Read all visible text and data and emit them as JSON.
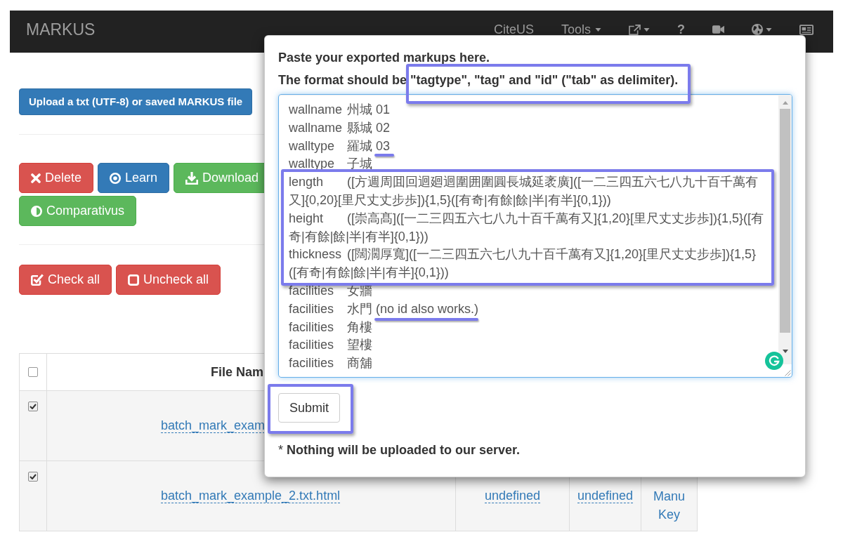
{
  "navbar": {
    "brand": "MARKUS",
    "items": [
      {
        "kind": "text",
        "label": "CiteUS",
        "dropdown": false
      },
      {
        "kind": "text",
        "label": "Tools",
        "dropdown": true
      },
      {
        "kind": "share",
        "dropdown": true
      },
      {
        "kind": "symbol",
        "label": "?",
        "dropdown": false
      },
      {
        "kind": "video",
        "dropdown": false
      },
      {
        "kind": "globe",
        "dropdown": true
      },
      {
        "kind": "newspaper",
        "dropdown": false
      }
    ]
  },
  "upload_button": {
    "label": "Upload a txt (UTF-8) or saved MARKUS file"
  },
  "actions": [
    {
      "kind": "delete",
      "label": "Delete"
    },
    {
      "kind": "learn",
      "label": "Learn"
    },
    {
      "kind": "download",
      "label": "Download"
    },
    {
      "kind": "compare",
      "label": "Comparativus"
    }
  ],
  "selection_buttons": [
    {
      "kind": "check",
      "label": "Check all"
    },
    {
      "kind": "uncheck",
      "label": "Uncheck all"
    }
  ],
  "table": {
    "header": {
      "checked": false,
      "columns": [
        "File Nam"
      ]
    },
    "rows": [
      {
        "checked": true,
        "cells": [
          "batch_mark_exam"
        ]
      },
      {
        "checked": true,
        "cells": [
          "batch_mark_example_2.txt.html",
          "undefined",
          "undefined",
          "Manu Key"
        ]
      }
    ]
  },
  "modal": {
    "intro": "Paste your exported markups here.",
    "format_note": "The format should be \"tagtype\", \"tag\" and \"id\" (\"tab\" as delimiter).",
    "markup_lines": [
      {
        "tagtype": "wallname",
        "value": "州城 01"
      },
      {
        "tagtype": "wallname",
        "value": "縣城 02"
      },
      {
        "tagtype": "walltype",
        "value": "羅城 03"
      },
      {
        "tagtype": "walltype",
        "value": "子城"
      },
      {
        "tagtype": "length",
        "value": "([方週周囬回迴廻迴圍囲圍圓長城延袤廣]([一二三四五六七八九十百千萬有又]{0,20}[里尺丈丈步歩]){1,5}([有奇|有餘|餘|半|有半]{0,1}))"
      },
      {
        "tagtype": "height",
        "value": "([崇高髙]([一二三四五六七八九十百千萬有又]{1,20}[里尺丈丈步歩]){1,5}([有奇|有餘|餘|半|有半]{0,1}))"
      },
      {
        "tagtype": "thickness",
        "value": "([闊濶厚寬]([一二三四五六七八九十百千萬有又]{1,20}[里尺丈丈步歩]){1,5}([有奇|有餘|餘|半|有半]{0,1}))"
      },
      {
        "tagtype": "facilities",
        "value": "女牆"
      },
      {
        "tagtype": "facilities",
        "value": "水門 (no id also works.)"
      },
      {
        "tagtype": "facilities",
        "value": "角樓"
      },
      {
        "tagtype": "facilities",
        "value": "望樓"
      },
      {
        "tagtype": "facilities",
        "value": "商舖"
      }
    ],
    "submit": "Submit",
    "footnote": "* **Nothing will be uploaded to our server.**"
  }
}
